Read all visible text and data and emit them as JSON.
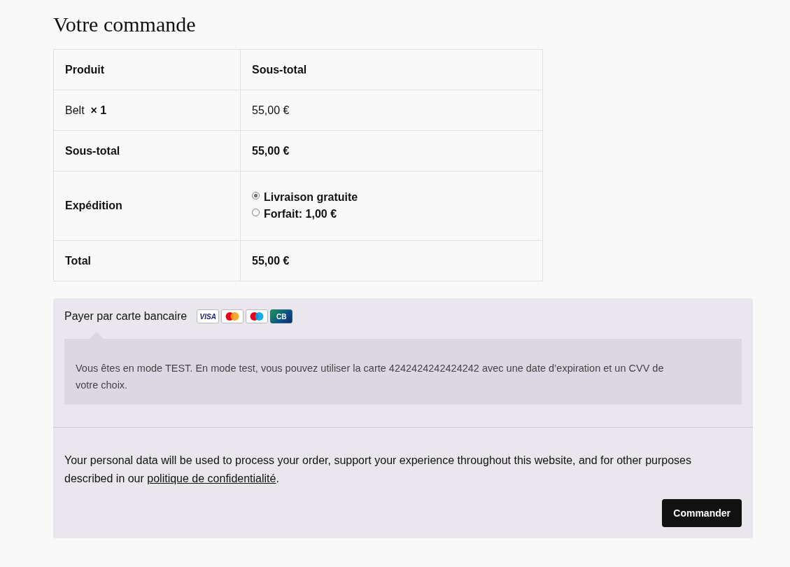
{
  "heading": "Votre commande",
  "table": {
    "columns": [
      "Produit",
      "Sous-total"
    ],
    "items": [
      {
        "product": "Belt  **× 1**",
        "subtotal": "55,00 €"
      }
    ],
    "subtotal": {
      "label": "Sous-total",
      "value": "55,00 €"
    },
    "shipping": {
      "label": "Expédition",
      "options": [
        {
          "label": "Livraison gratuite",
          "selected": true
        },
        {
          "label": "Forfait: 1,00 €",
          "selected": false
        }
      ]
    },
    "total": {
      "label": "Total",
      "value": "55,00 €"
    }
  },
  "payment": {
    "method": "Payer par carte bancaire",
    "cards": [
      {
        "kind": "visa",
        "label": "VISA"
      },
      {
        "kind": "mastercard"
      },
      {
        "kind": "maestro"
      },
      {
        "kind": "cb",
        "label": "CB"
      }
    ],
    "notice": "Vous êtes en mode TEST. En mode test, vous pouvez utiliser la carte 4242424242424242 avec une date d’expiration et un CVV de votre choix.",
    "privacy_text": "Your personal data will be used to process your order, support your experience throughout this website, and for other purposes described in our ",
    "privacy_link": "politique de confidentialité",
    "privacy_end": ".",
    "button": "Commander"
  }
}
